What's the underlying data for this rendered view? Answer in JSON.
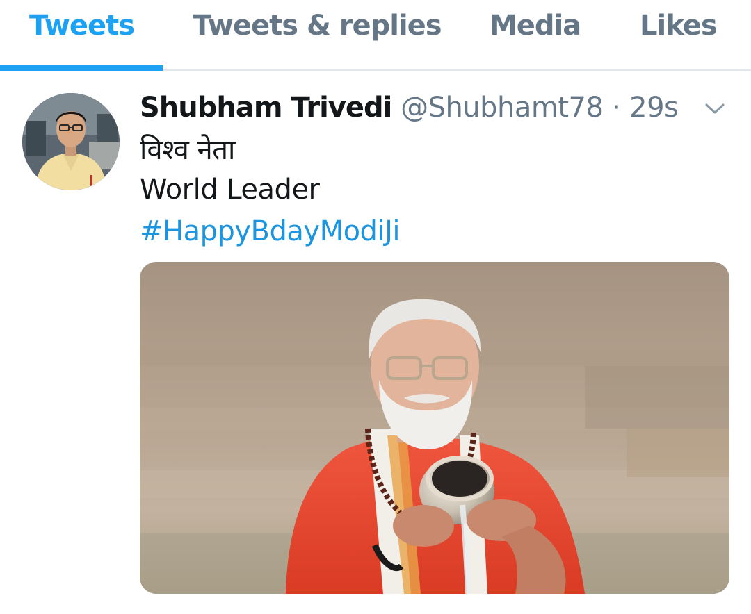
{
  "tabs": [
    {
      "label": "Tweets",
      "active": true
    },
    {
      "label": "Tweets & replies",
      "active": false
    },
    {
      "label": "Media",
      "active": false
    },
    {
      "label": "Likes",
      "active": false
    }
  ],
  "tweet": {
    "display_name": "Shubham Trivedi",
    "handle": "@Shubhamt78",
    "separator": "·",
    "timestamp": "29s",
    "text_hindi": "विश्व नेता",
    "text_english": "World Leader",
    "hashtag": "#HappyBdayModiJi",
    "menu_icon": "chevron-down-icon",
    "avatar_icon": "user-avatar-photo",
    "media_icon": "photo-man-pouring-water-at-river-ghat"
  },
  "colors": {
    "accent": "#1da1f2",
    "hashtag": "#1b95e0",
    "secondary_text": "#657786",
    "primary_text": "#14171a",
    "divider": "#e1e8ed"
  }
}
